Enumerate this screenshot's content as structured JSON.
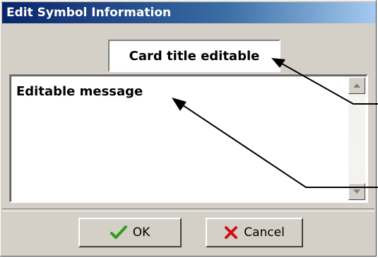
{
  "window": {
    "title": "Edit Symbol Information"
  },
  "card": {
    "title_value": "Card title editable",
    "message_value": "Editable message"
  },
  "buttons": {
    "ok_label": "OK",
    "cancel_label": "Cancel"
  },
  "icons": {
    "ok": "checkmark-icon",
    "cancel": "x-icon",
    "scroll_up": "arrow-up-icon",
    "scroll_down": "arrow-down-icon"
  },
  "colors": {
    "titlebar_start": "#0a246a",
    "titlebar_end": "#a6caf0",
    "face": "#d4d0c8",
    "check": "#2e9e1a",
    "cross": "#d01010"
  }
}
